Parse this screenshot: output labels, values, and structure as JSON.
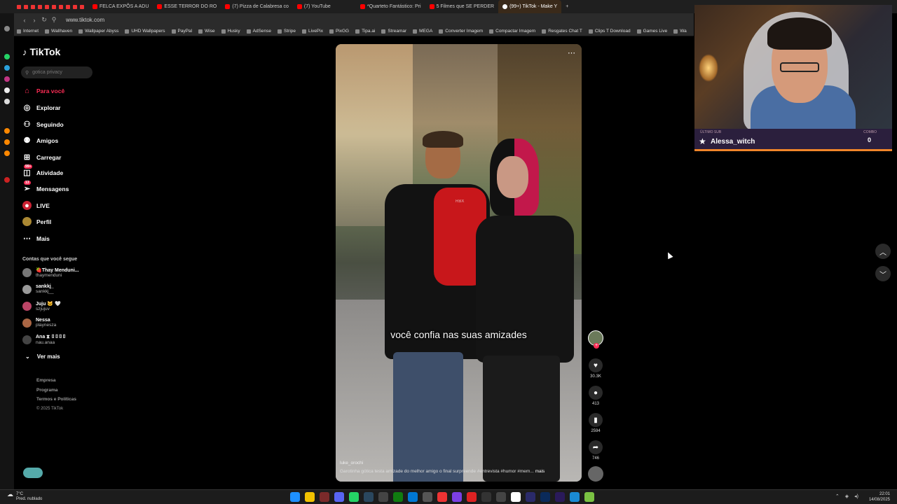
{
  "browser": {
    "tabs": [
      {
        "label": "FELCA EXPÕS A ADU",
        "icon": "youtube-icon"
      },
      {
        "label": "ESSE TERROR DO RO",
        "icon": "youtube-icon"
      },
      {
        "label": "(7) Pizza de Calabresa co",
        "icon": "youtube-icon"
      },
      {
        "label": "(7) YouTube",
        "icon": "youtube-icon"
      },
      {
        "label": "*Quarteto Fantástico: Pri",
        "icon": "youtube-icon"
      },
      {
        "label": "5 Filmes que SE PERDER",
        "icon": "youtube-icon"
      },
      {
        "label": "(99+) TikTok - Make Y",
        "icon": "tiktok-icon",
        "active": true
      }
    ],
    "url": "www.tiktok.com",
    "bookmarks": [
      "Internet",
      "Wallhaven",
      "Wallpaper Abyss",
      "UHD Wallpapers",
      "PayPal",
      "Wise",
      "Husky",
      "AdSense",
      "Stripe",
      "LivePix",
      "PixGG",
      "Tipa.ai",
      "Streamar",
      "MEGA",
      "Converter Imagem",
      "Compactar Imagem",
      "Resgates Chat T",
      "Clips T Download",
      "Games Live",
      "Wa"
    ]
  },
  "tiktok": {
    "logo": "TikTok",
    "search_placeholder": "gotica privacy",
    "nav": [
      {
        "label": "Para você",
        "icon": "home-icon",
        "active": true
      },
      {
        "label": "Explorar",
        "icon": "compass-icon"
      },
      {
        "label": "Seguindo",
        "icon": "following-icon"
      },
      {
        "label": "Amigos",
        "icon": "friends-icon"
      },
      {
        "label": "Carregar",
        "icon": "upload-icon"
      },
      {
        "label": "Atividade",
        "icon": "activity-icon",
        "badge": "99+"
      },
      {
        "label": "Mensagens",
        "icon": "messages-icon",
        "badge": "13"
      },
      {
        "label": "LIVE",
        "icon": "live-icon"
      },
      {
        "label": "Perfil",
        "icon": "profile-icon"
      },
      {
        "label": "Mais",
        "icon": "more-icon"
      }
    ],
    "following_title": "Contas que você segue",
    "following": [
      {
        "name": "🍓Thay Menduni...",
        "handle": "thaymenduni"
      },
      {
        "name": "sankkj_",
        "handle": "sankkj__"
      },
      {
        "name": "Juju 🐱 🤍",
        "handle": "szjujuv"
      },
      {
        "name": "Nessa",
        "handle": "playnesza"
      },
      {
        "name": "Ana ⧗ ▯▯▯▯",
        "handle": "nau.anaa"
      }
    ],
    "see_more": "Ver mais",
    "footer": [
      "Empresa",
      "Programa",
      "Termos e Políticas"
    ],
    "copyright": "© 2025 TikTok"
  },
  "video": {
    "subtitle": "você confia nas suas amizades",
    "watermark": "RBX",
    "author": "luke_orochi",
    "description": "Garotinha gótica testa amizade do melhor amigo o final surpreende #entrevista  #humor  #mem...",
    "more_label": "mais",
    "likes": "30.3K",
    "comments": "413",
    "saves": "2594",
    "shares": "746"
  },
  "overlay": {
    "last_sub_label": "ÚLTIMO SUB",
    "last_sub_name": "Alessa_witch",
    "combo_label": "COMBO",
    "combo_value": "0"
  },
  "taskbar": {
    "weather_temp": "7°C",
    "weather_desc": "Pred. nublado",
    "time": "22:01",
    "date": "14/08/2025"
  },
  "colors": {
    "tiktok_accent": "#fe2c55",
    "overlay_bar": "#f0852a"
  }
}
